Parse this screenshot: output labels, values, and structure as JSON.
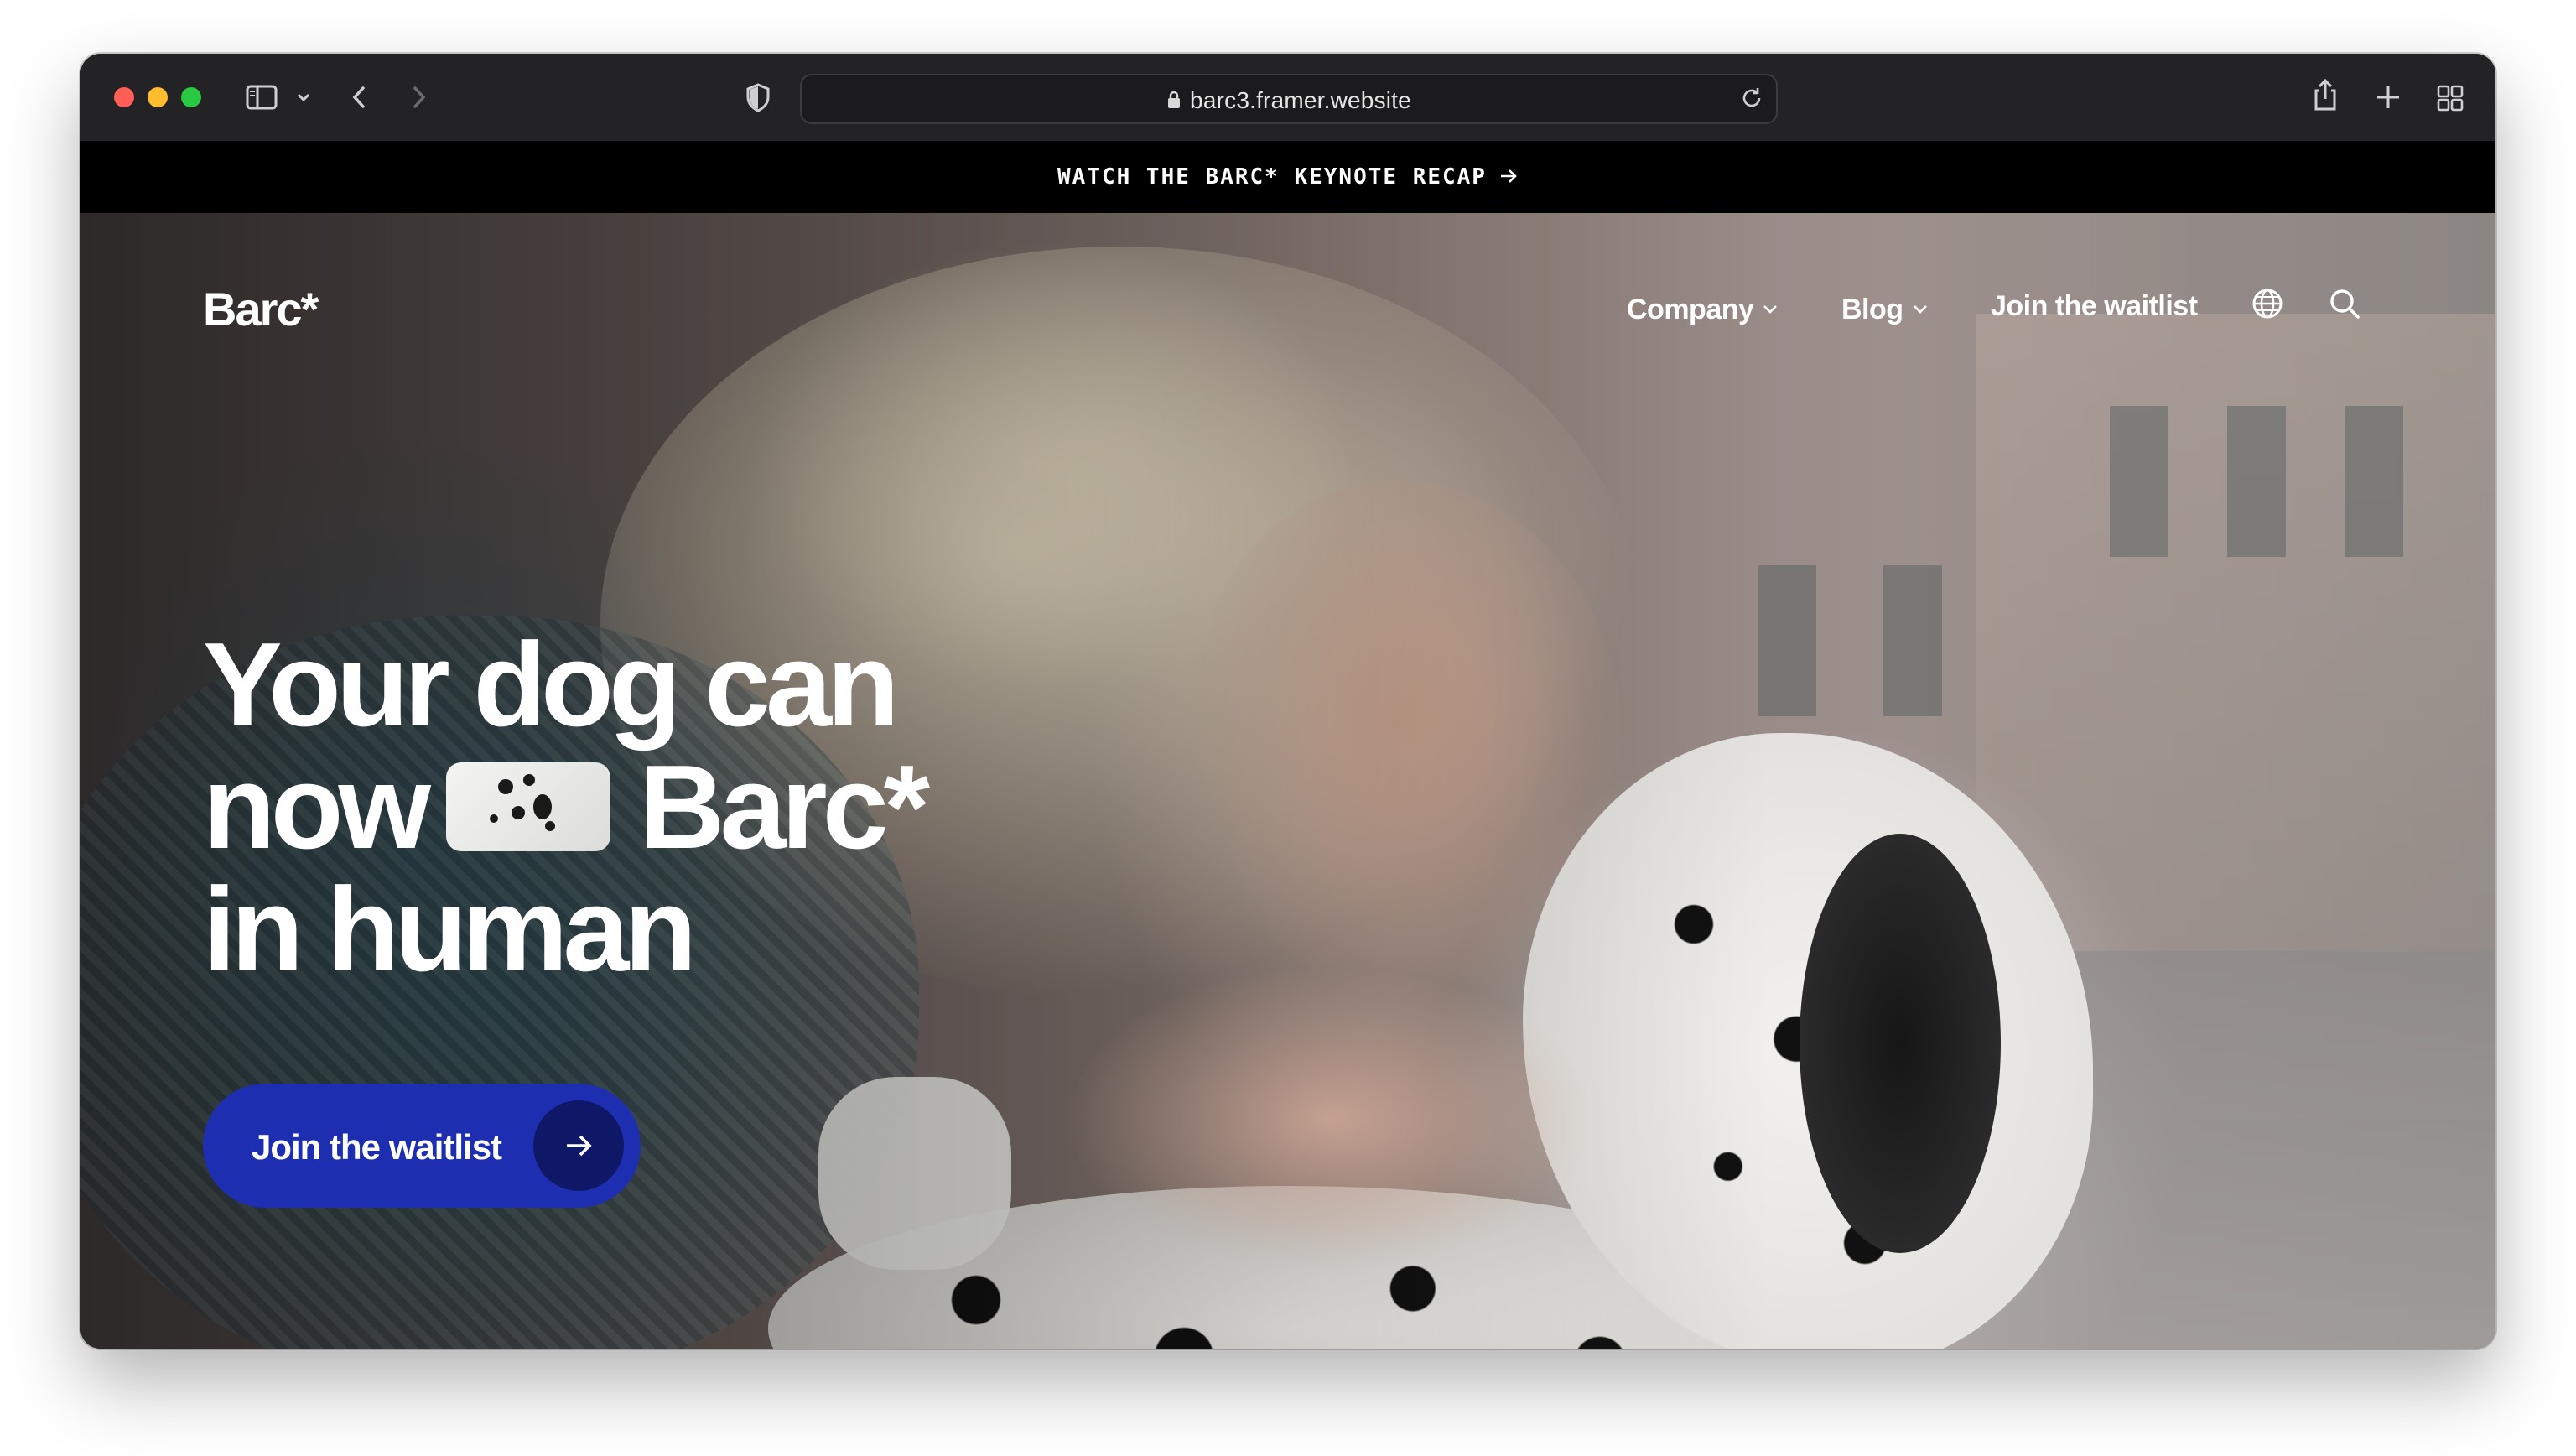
{
  "browser": {
    "url": "barc3.framer.website",
    "icons": [
      "sidebar-icon",
      "chevron-down-icon",
      "back-icon",
      "forward-icon",
      "shield-icon",
      "lock-icon",
      "reload-icon",
      "share-icon",
      "new-tab-icon",
      "tab-overview-icon"
    ]
  },
  "announcement": {
    "text": "WATCH THE BARC* KEYNOTE RECAP",
    "icon": "arrow-right-icon"
  },
  "nav": {
    "logo": "Barc*",
    "items": [
      {
        "label": "Company",
        "icon": "chevron-down-icon"
      },
      {
        "label": "Blog",
        "icon": "chevron-down-icon"
      },
      {
        "label": "Join the waitlist"
      }
    ],
    "icons": [
      "globe-icon",
      "search-icon"
    ]
  },
  "hero": {
    "line1": "Your dog can",
    "line2_start": "now",
    "line2_end": "Barc*",
    "line3": "in human",
    "cta_label": "Join the waitlist",
    "cta_icon": "arrow-right-icon"
  },
  "colors": {
    "cta_background": "#1d2fb0",
    "cta_icon_background": "#0f1866",
    "announcement_background": "#000000",
    "toolbar_background": "#232325"
  }
}
